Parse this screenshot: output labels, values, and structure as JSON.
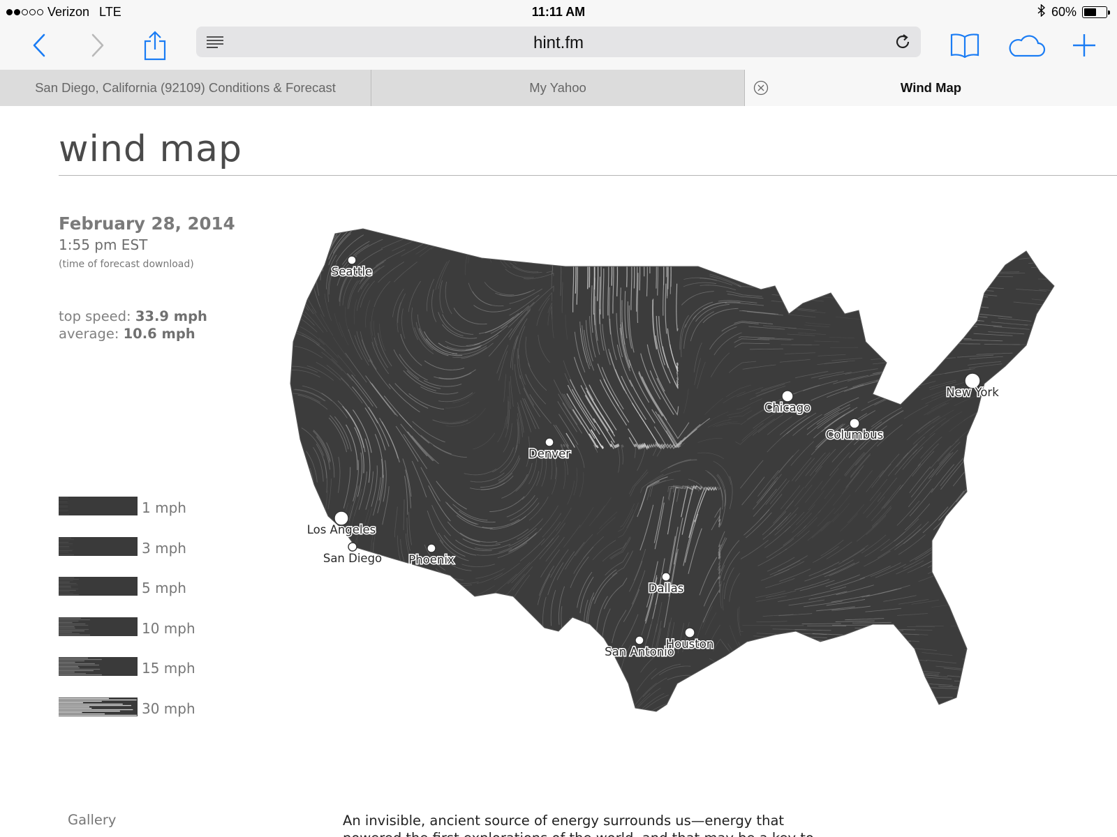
{
  "status_bar": {
    "carrier": "Verizon",
    "network": "LTE",
    "time": "11:11 AM",
    "battery_text": "60%",
    "battery_level": 0.6,
    "signal_bars_filled": 2,
    "signal_bars_total": 5
  },
  "toolbar": {
    "url": "hint.fm",
    "icons": [
      "back-icon",
      "forward-icon",
      "share-icon",
      "reader-icon",
      "reload-icon",
      "bookmarks-icon",
      "cloud-tabs-icon",
      "new-tab-icon"
    ],
    "accent_color": "#1a7cf4"
  },
  "tabs": [
    {
      "label": "San Diego, California (92109) Conditions & Forecast",
      "active": false
    },
    {
      "label": "My Yahoo",
      "active": false
    },
    {
      "label": "Wind Map",
      "active": true
    }
  ],
  "page": {
    "title": "wind map",
    "date": "February 28, 2014",
    "time": "1:55 pm EST",
    "time_note": "(time of forecast download)",
    "top_speed_label": "top speed:",
    "top_speed_value": "33.9 mph",
    "average_label": "average:",
    "average_value": "10.6 mph",
    "legend": [
      {
        "label": "1 mph",
        "level": 0.03
      },
      {
        "label": "3 mph",
        "level": 0.1
      },
      {
        "label": "5 mph",
        "level": 0.17
      },
      {
        "label": "10 mph",
        "level": 0.33
      },
      {
        "label": "15 mph",
        "level": 0.5
      },
      {
        "label": "30 mph",
        "level": 1.0
      }
    ],
    "cities": [
      "Seattle",
      "Chicago",
      "New York",
      "Columbus",
      "Denver",
      "Los Angeles",
      "San Diego",
      "Phoenix",
      "Dallas",
      "San Antonio",
      "Houston"
    ],
    "footer_link": "Gallery",
    "footer_text": "An invisible, ancient source of energy surrounds us—energy that powered the first explorations of the world, and that may be a key to"
  }
}
